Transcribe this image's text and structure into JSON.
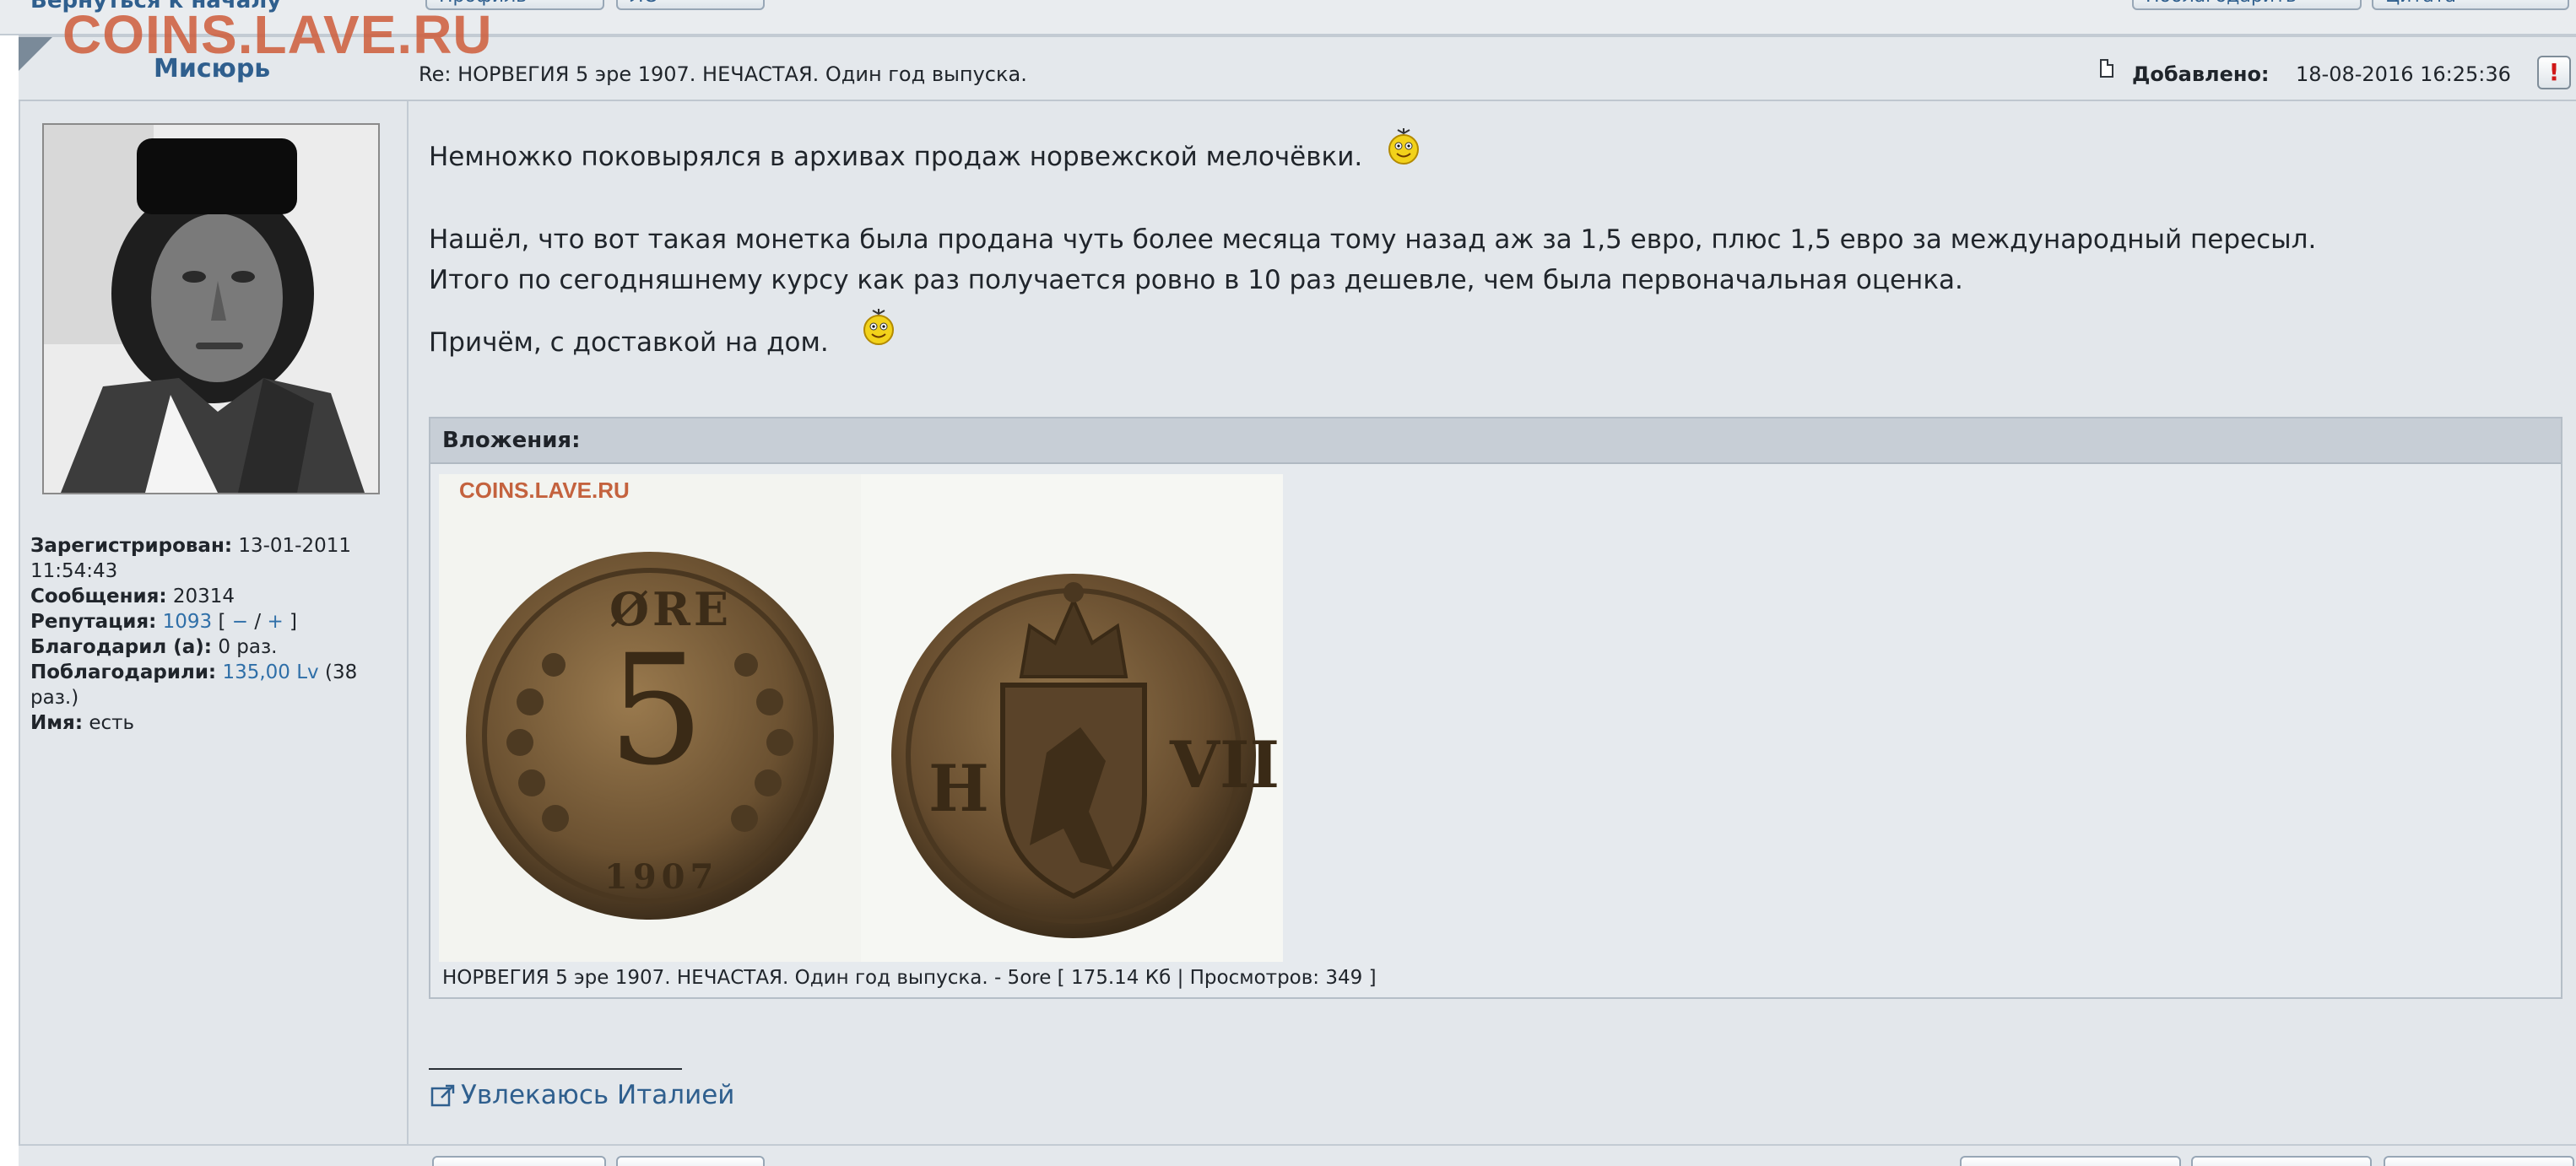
{
  "watermark": "COINS.LAVE.RU",
  "topbar": {
    "back_link": "Вернуться к началу",
    "profile_button": "Профиль",
    "pm_button": "ЛС",
    "thank_button": "Поблагодарить",
    "quote_button": "Цитата"
  },
  "post": {
    "author": "Мисюрь",
    "subject": "Re: НОРВЕГИЯ 5 эре 1907. НЕЧАСТАЯ. Один год выпуска.",
    "added_label": "Добавлено:",
    "added_value": "18-08-2016 16:25:36",
    "report_symbol": "!"
  },
  "profile": {
    "registered_label": "Зарегистрирован:",
    "registered_value": "13-01-2011 11:54:43",
    "messages_label": "Сообщения:",
    "messages_value": "20314",
    "reputation_label": "Репутация:",
    "reputation_value": "1093",
    "reputation_open": "[",
    "reputation_minus": "−",
    "reputation_sep": "/",
    "reputation_plus": "+",
    "reputation_close": "]",
    "thanked_label": "Благодарил (а):",
    "thanked_value": "0 раз.",
    "was_thanked_label": "Поблагодарили:",
    "was_thanked_value": "135,00 Lv",
    "was_thanked_count": "(38 раз.)",
    "name_label": "Имя:",
    "name_value": "есть"
  },
  "message": {
    "line1": "Немножко поковырялся в архивах продаж норвежской мелочёвки.",
    "line2": "Нашёл, что вот такая монетка была продана чуть более месяца тому назад аж за 1,5 евро, плюс 1,5 евро за международный пересыл.",
    "line3": "Итого по сегодняшнему курсу как раз получается ровно в 10 раз дешевле, чем была первоначальная оценка.",
    "line4": "Причём, с доставкой на дом."
  },
  "attachments": {
    "title": "Вложения:",
    "image_watermark": "COINS.LAVE.RU",
    "coin_obverse_text": "ØRE",
    "coin_value": "5",
    "coin_year": "1907",
    "coin_left_letter": "H",
    "coin_right_letters": "VII",
    "caption": "НОРВЕГИЯ 5 эре 1907. НЕЧАСТАЯ. Один год выпуска. - 5ore [ 175.14 Кб | Просмотров: 349 ]"
  },
  "signature": {
    "link_text": "Увлекаюсь Италией"
  },
  "colors": {
    "link": "#2f5f8e",
    "panel": "#e3e7eb",
    "header": "#e4e8ec",
    "attach_header": "#c7ced6",
    "watermark": "#ce5c3a"
  }
}
